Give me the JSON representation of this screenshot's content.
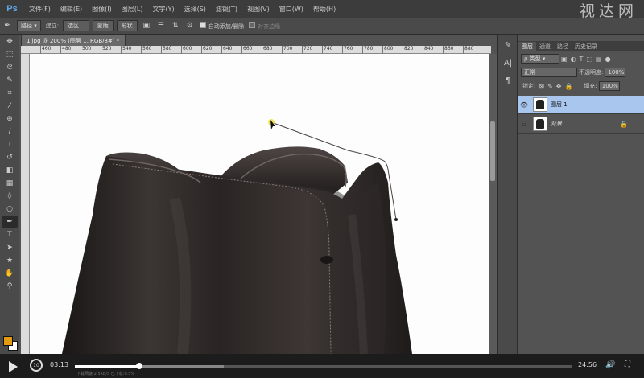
{
  "app": {
    "logo": "Ps"
  },
  "menu": [
    "文件(F)",
    "编辑(E)",
    "图像(I)",
    "图层(L)",
    "文字(Y)",
    "选择(S)",
    "滤镜(T)",
    "视图(V)",
    "窗口(W)",
    "帮助(H)"
  ],
  "watermark": "视达网",
  "options": {
    "mode": "路径",
    "build_label": "建立:",
    "selection_btn": "选区...",
    "mask_btn": "蒙版",
    "shape_btn": "形状",
    "auto_add_label": "自动添加/删除",
    "auto_add_checked": true,
    "align_edges_label": "对齐边缘",
    "align_edges_checked": false
  },
  "document": {
    "tab_title": "1.jpg @ 200% (图层 1, RGB/8#) *",
    "ruler_ticks": [
      "460",
      "480",
      "500",
      "520",
      "540",
      "560",
      "580",
      "600",
      "620",
      "640",
      "660",
      "680",
      "700",
      "720",
      "740",
      "760",
      "780",
      "800",
      "820",
      "840",
      "860",
      "880"
    ],
    "vertical_scroll_fraction": 0.28
  },
  "tools": [
    "move-icon",
    "marquee-icon",
    "lasso-icon",
    "quick-select-icon",
    "crop-icon",
    "eyedropper-icon",
    "healing-icon",
    "brush-icon",
    "stamp-icon",
    "history-brush-icon",
    "eraser-icon",
    "gradient-icon",
    "blur-icon",
    "dodge-icon",
    "pen-icon",
    "type-icon",
    "path-select-icon",
    "shape-icon",
    "hand-icon",
    "zoom-icon"
  ],
  "active_tool": "pen-icon",
  "colors": {
    "foreground": "#e59b10",
    "background": "#ffffff",
    "layer_selected": "#a9c6ef"
  },
  "panel": {
    "tabs": [
      "图层",
      "通道",
      "路径",
      "历史记录"
    ],
    "active_tab": "图层",
    "kind_filter": "ρ 类型",
    "blend_mode": "正常",
    "opacity_label": "不透明度:",
    "opacity_value": "100%",
    "lock_label": "锁定:",
    "fill_label": "填充:",
    "fill_value": "100%",
    "layers": [
      {
        "name": "图层 1",
        "visible": true,
        "selected": true
      },
      {
        "name": "背景",
        "visible": false,
        "selected": false,
        "locked": true
      }
    ]
  },
  "player": {
    "current_time": "03:13",
    "total_time": "24:56",
    "progress_fraction": 0.129,
    "download_info": "下载网速:2.5KB/S 已下载:0.5%",
    "rewind_label": "10"
  }
}
